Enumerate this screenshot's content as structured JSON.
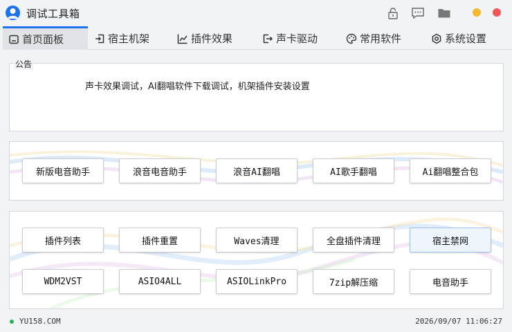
{
  "window": {
    "title": "调试工具箱",
    "icons": [
      "lock-icon",
      "chat-icon",
      "folder-icon"
    ],
    "controls": {
      "minimize_color": "#f5b82e",
      "close_color": "#f0575b"
    }
  },
  "tabs": [
    {
      "label": "首页面板",
      "icon": "home-icon",
      "active": true
    },
    {
      "label": "宿主机架",
      "icon": "login-icon",
      "active": false
    },
    {
      "label": "插件效果",
      "icon": "chart-icon",
      "active": false
    },
    {
      "label": "声卡驱动",
      "icon": "exit-icon",
      "active": false
    },
    {
      "label": "常用软件",
      "icon": "palette-icon",
      "active": false
    },
    {
      "label": "系统设置",
      "icon": "settings-icon",
      "active": false
    }
  ],
  "notice": {
    "legend": "公告",
    "text": "声卡效果调试，AI翻唱软件下载调试，机架插件安装设置"
  },
  "group1": [
    "新版电音助手",
    "浪音电音助手",
    "浪音AI翻唱",
    "AI歌手翻唱",
    "Ai翻唱整合包"
  ],
  "group2_row1": [
    "插件列表",
    "插件重置",
    "Waves清理",
    "全盘插件清理",
    "宿主禁网"
  ],
  "group2_row2": [
    "WDM2VST",
    "ASIO4ALL",
    "ASIOLinkPro",
    "7zip解压缩",
    "电音助手"
  ],
  "status": {
    "site": "YU158.COM",
    "datetime": "2026/09/07 11:06:27",
    "online_color": "#2bb24c"
  },
  "accent": "#1e73e8"
}
